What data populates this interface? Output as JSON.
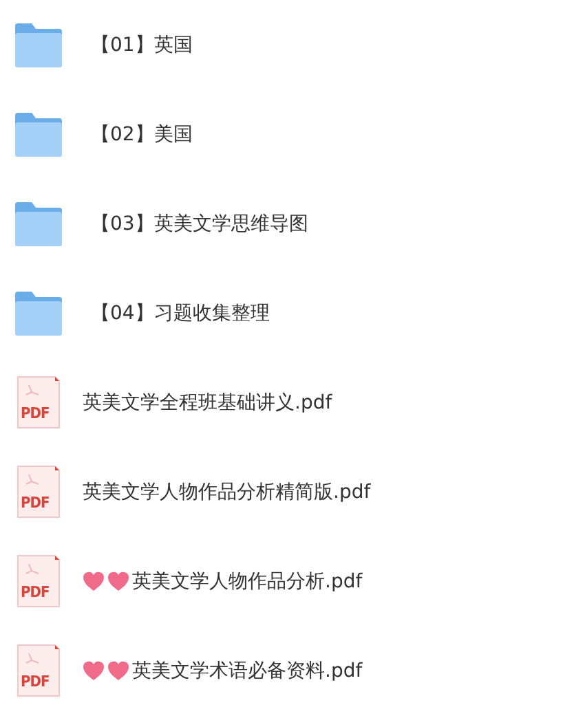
{
  "files": [
    {
      "kind": "folder",
      "name": "【01】英国",
      "favorite": false
    },
    {
      "kind": "folder",
      "name": "【02】美国",
      "favorite": false
    },
    {
      "kind": "folder",
      "name": "【03】英美文学思维导图",
      "favorite": false
    },
    {
      "kind": "folder",
      "name": "【04】习题收集整理",
      "favorite": false
    },
    {
      "kind": "pdf",
      "badge": "PDF",
      "name": "英美文学全程班基础讲义.pdf",
      "favorite": false
    },
    {
      "kind": "pdf",
      "badge": "PDF",
      "name": "英美文学人物作品分析精简版.pdf",
      "favorite": false
    },
    {
      "kind": "pdf",
      "badge": "PDF",
      "name": "英美文学人物作品分析.pdf",
      "favorite": true
    },
    {
      "kind": "pdf",
      "badge": "PDF",
      "name": "英美文学术语必备资料.pdf",
      "favorite": true
    }
  ]
}
